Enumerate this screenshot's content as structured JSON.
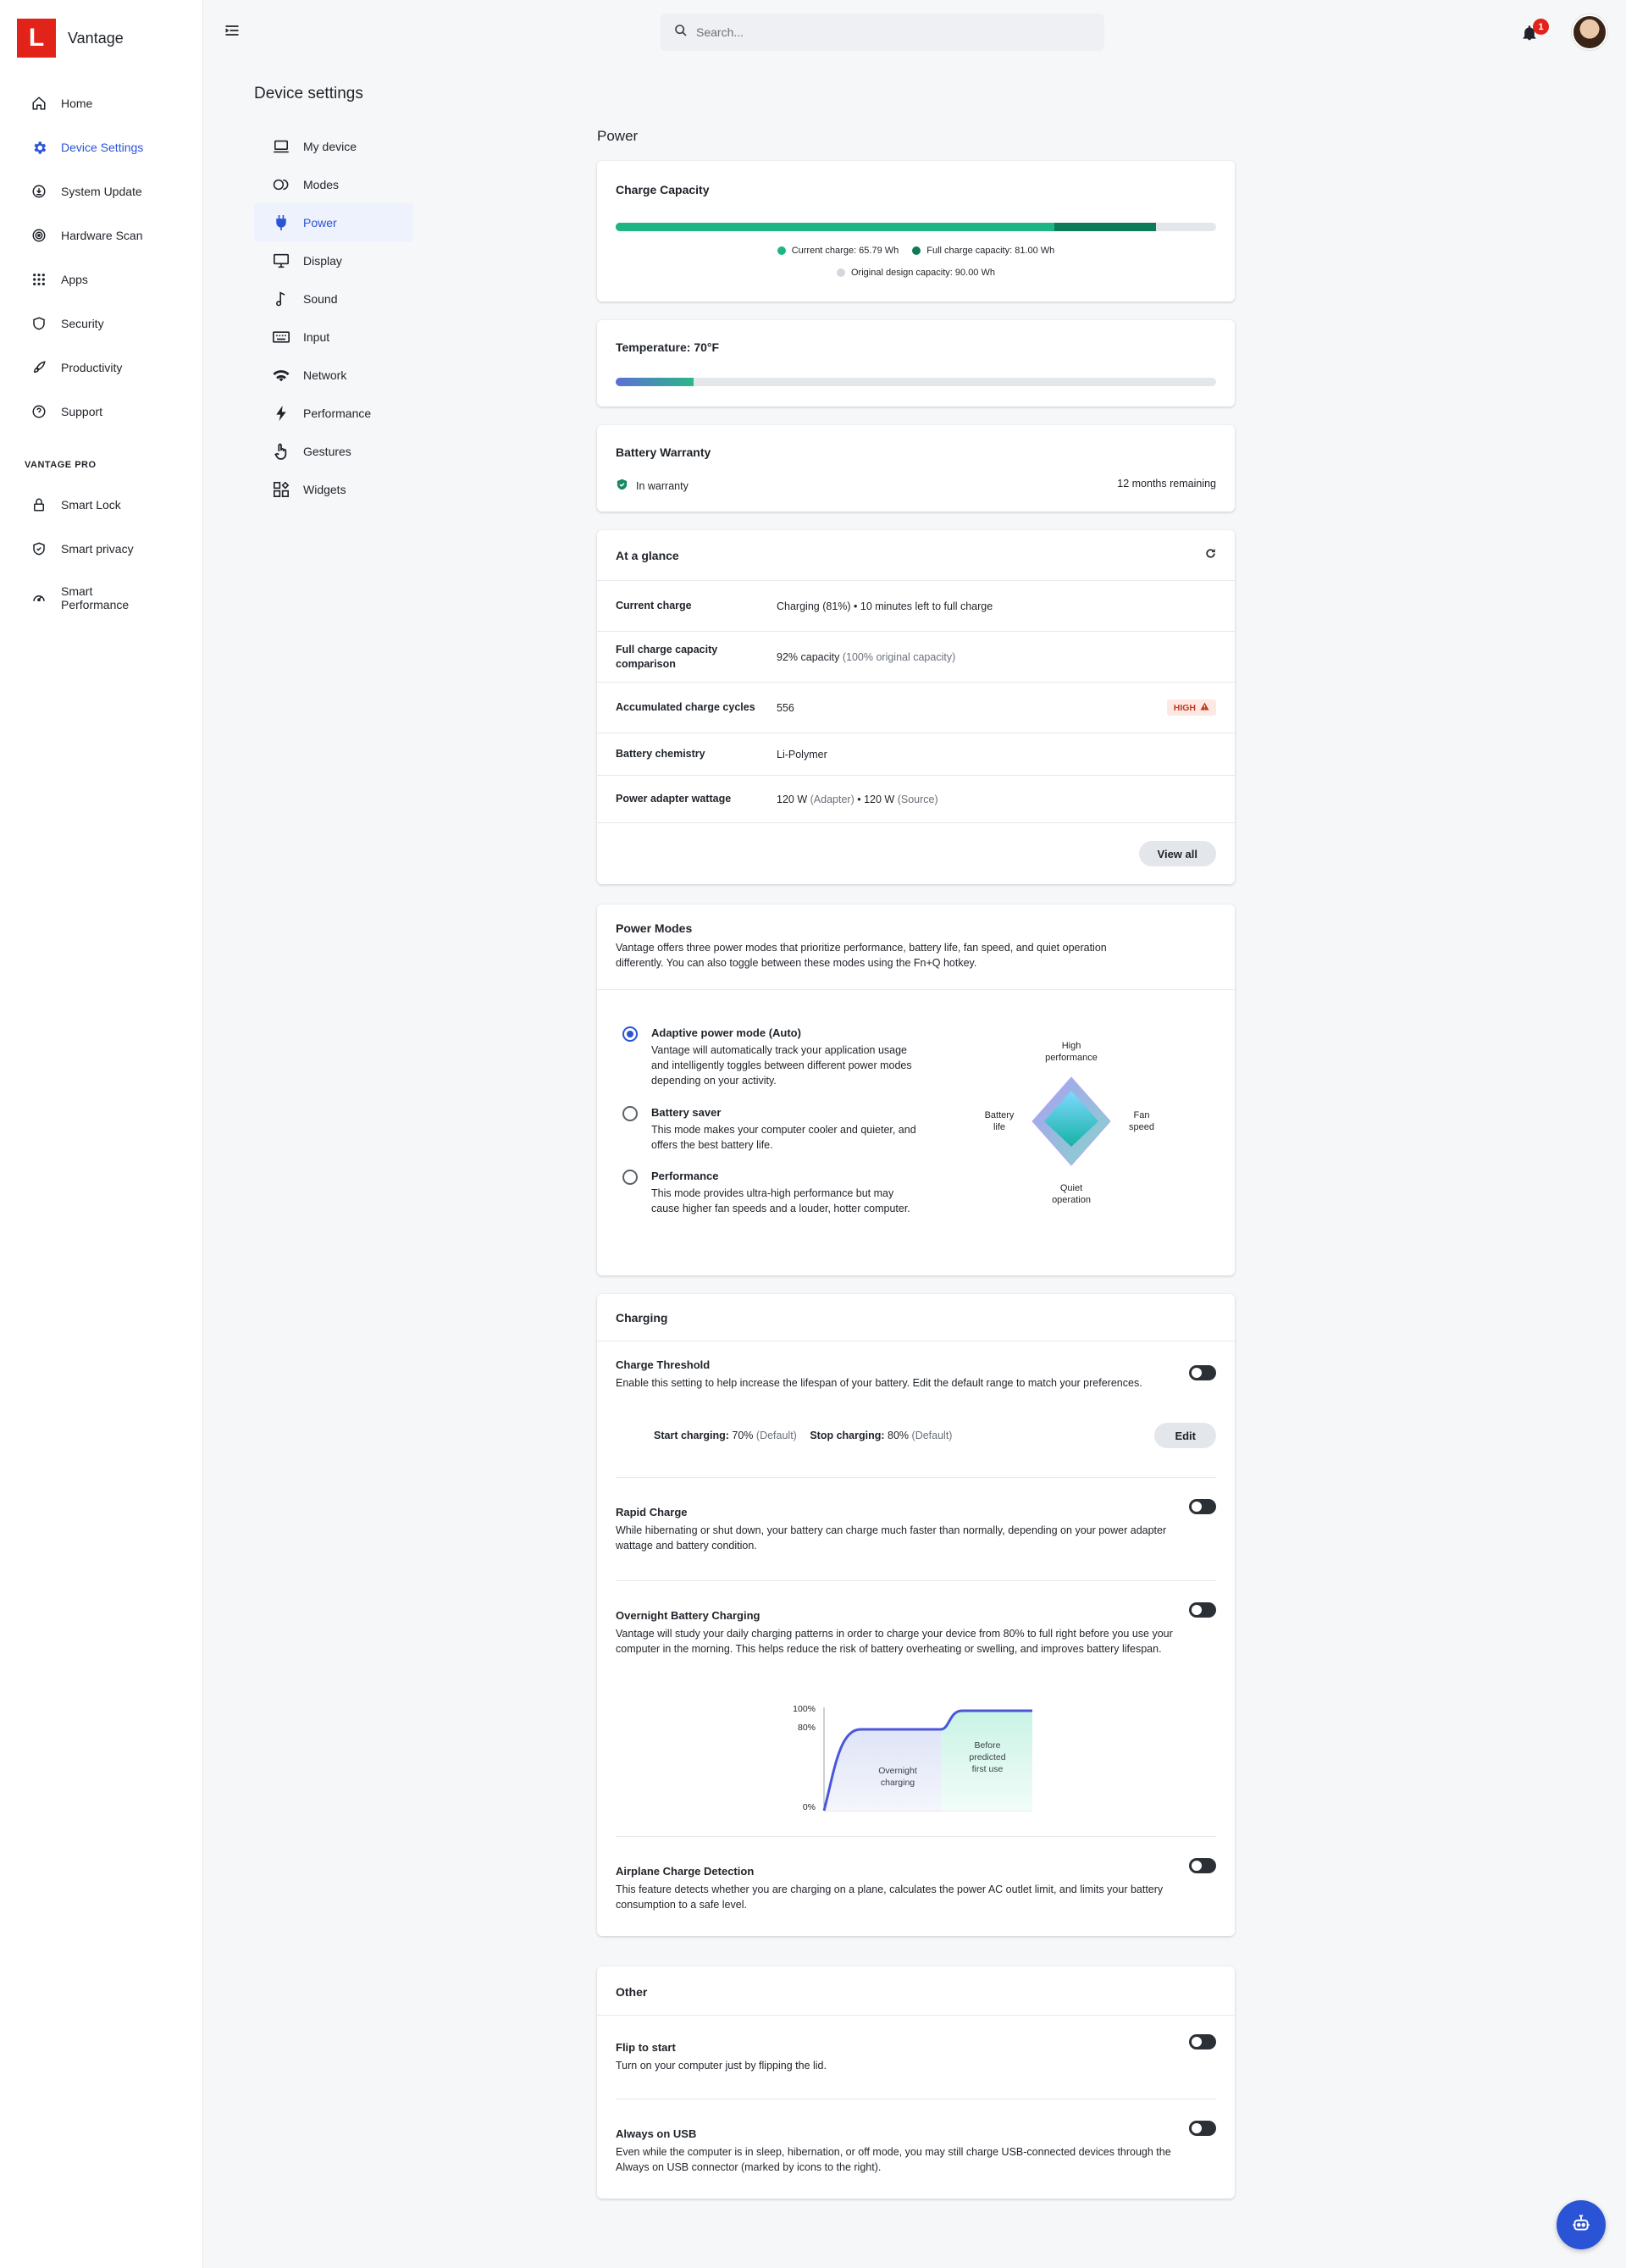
{
  "app": {
    "name": "Vantage",
    "logo_letter": "L",
    "brand_color": "#e2231a",
    "accent_color": "#2a53d6"
  },
  "search": {
    "placeholder": "Search..."
  },
  "notifications": {
    "count": "1"
  },
  "nav": {
    "items": [
      {
        "label": "Home",
        "icon": "home-icon"
      },
      {
        "label": "Device Settings",
        "icon": "gear-icon",
        "active": true
      },
      {
        "label": "System Update",
        "icon": "update-icon"
      },
      {
        "label": "Hardware Scan",
        "icon": "scan-icon"
      },
      {
        "label": "Apps",
        "icon": "apps-grid-icon"
      },
      {
        "label": "Security",
        "icon": "shield-icon"
      },
      {
        "label": "Productivity",
        "icon": "rocket-icon"
      },
      {
        "label": "Support",
        "icon": "help-icon"
      }
    ],
    "pro_section": "VANTAGE PRO",
    "pro_items": [
      {
        "label": "Smart Lock",
        "icon": "lock-icon"
      },
      {
        "label": "Smart privacy",
        "icon": "privacy-shield-icon"
      },
      {
        "label": "Smart Performance",
        "icon": "gauge-icon"
      }
    ]
  },
  "subnav": {
    "title": "Device settings",
    "items": [
      {
        "label": "My device",
        "icon": "laptop-icon"
      },
      {
        "label": "Modes",
        "icon": "modes-icon"
      },
      {
        "label": "Power",
        "icon": "plug-icon",
        "active": true
      },
      {
        "label": "Display",
        "icon": "monitor-icon"
      },
      {
        "label": "Sound",
        "icon": "music-note-icon"
      },
      {
        "label": "Input",
        "icon": "keyboard-icon"
      },
      {
        "label": "Network",
        "icon": "wifi-icon"
      },
      {
        "label": "Performance",
        "icon": "bolt-icon"
      },
      {
        "label": "Gestures",
        "icon": "gesture-hand-icon"
      },
      {
        "label": "Widgets",
        "icon": "widgets-icon"
      }
    ]
  },
  "power": {
    "title": "Power",
    "charge_capacity": {
      "title": "Charge Capacity",
      "current_charge": 65.79,
      "full_charge_capacity": 81.0,
      "design_capacity": 90.0,
      "legend_current": "Current charge:  65.79 Wh",
      "legend_full": "Full charge capacity: 81.00 Wh",
      "legend_design": "Original design capacity: 90.00 Wh",
      "color_current": "#1db584",
      "color_full": "#0f7a57",
      "color_design": "#d4d8dd"
    },
    "temperature": {
      "title": "Temperature:  70°F",
      "level": 0.13
    },
    "warranty": {
      "title": "Battery Warranty",
      "status": "In warranty",
      "remaining": "12 months remaining"
    },
    "glance": {
      "title": "At a glance",
      "rows": [
        {
          "key": "Current charge",
          "value": "Charging (81%)  •  10 minutes left to full charge"
        },
        {
          "key": "Full charge capacity comparison",
          "value": "92% capacity",
          "extra": "(100% original capacity)"
        },
        {
          "key": "Accumulated charge cycles",
          "value": "556",
          "badge": "HIGH"
        },
        {
          "key": "Battery chemistry",
          "value": "Li-Polymer"
        },
        {
          "key": "Power adapter wattage",
          "value_a": "120 W",
          "note_a": "(Adapter)",
          "sep": " • ",
          "value_b": "120 W",
          "note_b": "(Source)"
        }
      ],
      "view_all": "View all"
    },
    "modes": {
      "title": "Power Modes",
      "description": "Vantage offers three power modes that prioritize performance, battery life, fan speed, and quiet operation differently. You can also toggle between these modes using the Fn+Q hotkey.",
      "options": [
        {
          "name": "Adaptive power mode (Auto)",
          "desc": "Vantage will automatically track your application usage and intelligently toggles between different power modes depending on your activity.",
          "selected": true
        },
        {
          "name": "Battery saver",
          "desc": "This mode makes your computer cooler and quieter, and offers the best battery life.",
          "selected": false
        },
        {
          "name": "Performance",
          "desc": "This mode provides ultra-high performance but may cause higher fan speeds and a louder, hotter computer.",
          "selected": false
        }
      ],
      "diagram": {
        "top_line1": "High",
        "top_line2": "performance",
        "left_line1": "Battery",
        "left_line2": "life",
        "right_line1": "Fan",
        "right_line2": "speed",
        "bottom_line1": "Quiet",
        "bottom_line2": "operation"
      }
    },
    "charging": {
      "title": "Charging",
      "threshold": {
        "title": "Charge Threshold",
        "desc": "Enable this setting to help increase the lifespan of your battery. Edit the default range to match your preferences.",
        "start_label": "Start charging:",
        "start_value": "70%",
        "start_note": "(Default)",
        "stop_label": "Stop charging:",
        "stop_value": "80%",
        "stop_note": "(Default)",
        "edit": "Edit"
      },
      "rapid": {
        "title": "Rapid Charge",
        "desc": "While hibernating or shut down, your battery can charge much faster than normally, depending on your power adapter wattage and battery condition."
      },
      "overnight": {
        "title": "Overnight Battery Charging",
        "desc": "Vantage will study your daily charging patterns in order to charge your device from 80% to full right before you use your computer in the morning. This helps reduce the risk of battery overheating or swelling, and improves battery lifespan.",
        "chart": {
          "y100": "100%",
          "y80": "80%",
          "y0": "0%",
          "region1_line1": "Overnight",
          "region1_line2": "charging",
          "region2_line1": "Before",
          "region2_line2": "predicted",
          "region2_line3": "first use"
        }
      },
      "airplane": {
        "title": "Airplane Charge Detection",
        "desc": "This feature detects whether you are charging on a plane, calculates the power AC outlet limit, and limits your battery consumption to a safe level."
      }
    },
    "other": {
      "title": "Other",
      "flip": {
        "title": "Flip to start",
        "desc": "Turn on your computer just by flipping the lid."
      },
      "usb": {
        "title": "Always on USB",
        "desc": "Even while the computer is in sleep, hibernation, or off mode, you may still charge USB-connected devices through the Always on USB connector (marked by icons to the right)."
      }
    }
  }
}
